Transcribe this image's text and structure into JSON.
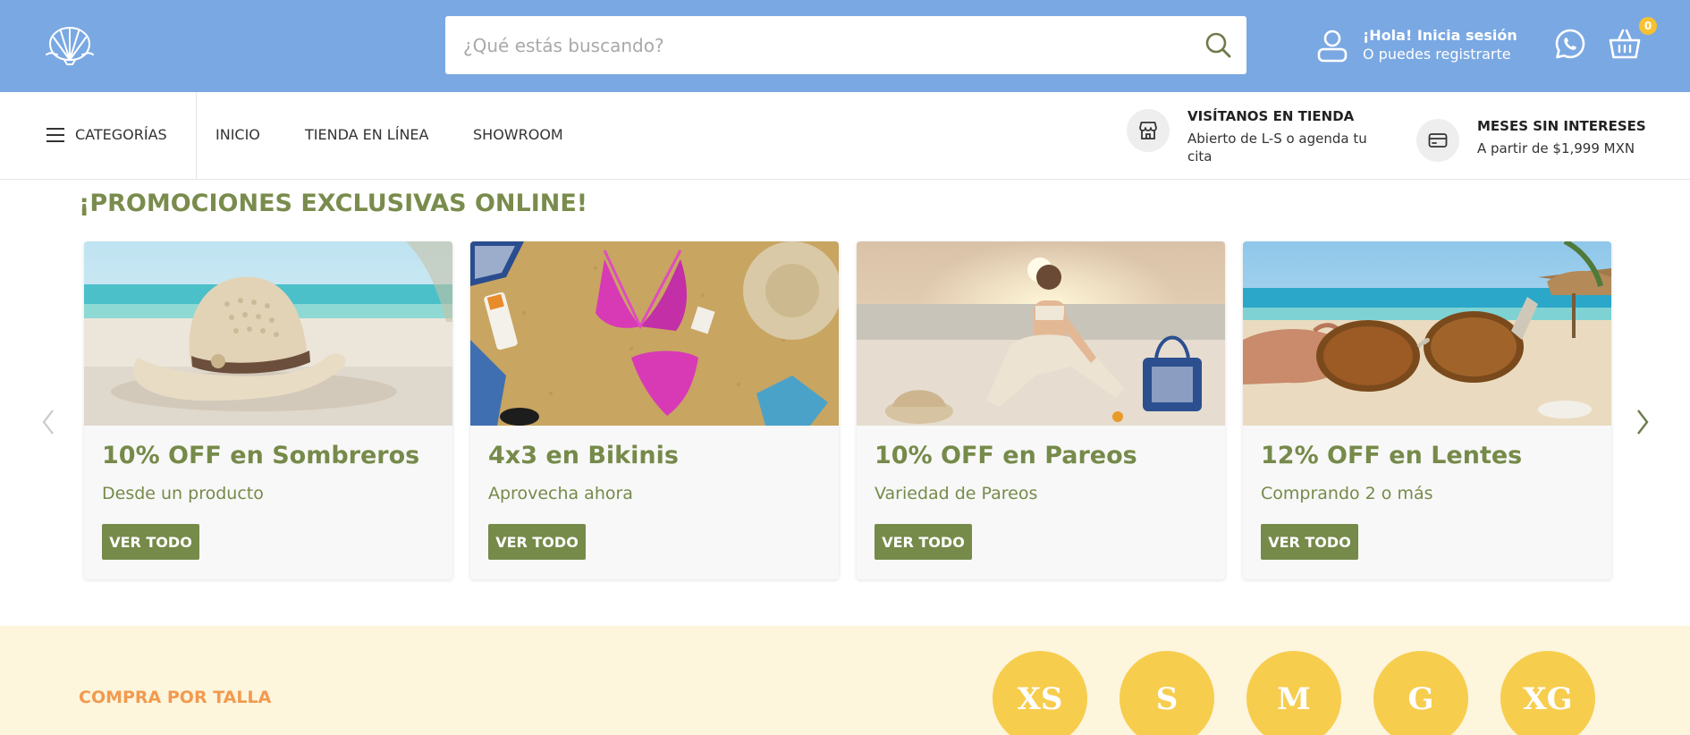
{
  "header": {
    "search": {
      "placeholder": "¿Qué estás buscando?",
      "value": ""
    },
    "login": {
      "line1": "¡Hola! Inicia sesión",
      "line2": "O puedes registrarte"
    },
    "cart": {
      "count": "0"
    },
    "colors": {
      "bar": "#7aa8e3",
      "badge": "#f6c232"
    }
  },
  "nav": {
    "categories_label": "CATEGORÍAS",
    "links": [
      "INICIO",
      "TIENDA EN LÍNEA",
      "SHOWROOM"
    ],
    "store_info": {
      "title": "VISÍTANOS EN TIENDA",
      "text": "Abierto de L-S o agenda tu cita",
      "icon": "store-icon"
    },
    "credit_info": {
      "title": "MESES SIN INTERESES",
      "text": "A partir de $1,999 MXN",
      "icon": "credit-card-icon"
    }
  },
  "promos": {
    "title": "¡PROMOCIONES EXCLUSIVAS ONLINE!",
    "cards": [
      {
        "title": "10% OFF en Sombreros",
        "subtitle": "Desde un producto",
        "button": "VER TODO",
        "image": "straw-hat-on-beach"
      },
      {
        "title": "4x3 en Bikinis",
        "subtitle": "Aprovecha ahora",
        "button": "VER TODO",
        "image": "pink-bikini-on-sand"
      },
      {
        "title": "10% OFF en Pareos",
        "subtitle": "Variedad de Pareos",
        "button": "VER TODO",
        "image": "woman-in-crochet-outfit-on-beach"
      },
      {
        "title": "12% OFF en Lentes",
        "subtitle": "Comprando 2 o más",
        "button": "VER TODO",
        "image": "hand-holding-sunglasses-beach"
      }
    ],
    "accent": "#768a4a"
  },
  "sizes": {
    "title": "COMPRA POR TALLA",
    "items": [
      "XS",
      "S",
      "M",
      "G",
      "XG"
    ],
    "circle_color": "#f7cd4e",
    "title_color": "#f19a4f"
  }
}
